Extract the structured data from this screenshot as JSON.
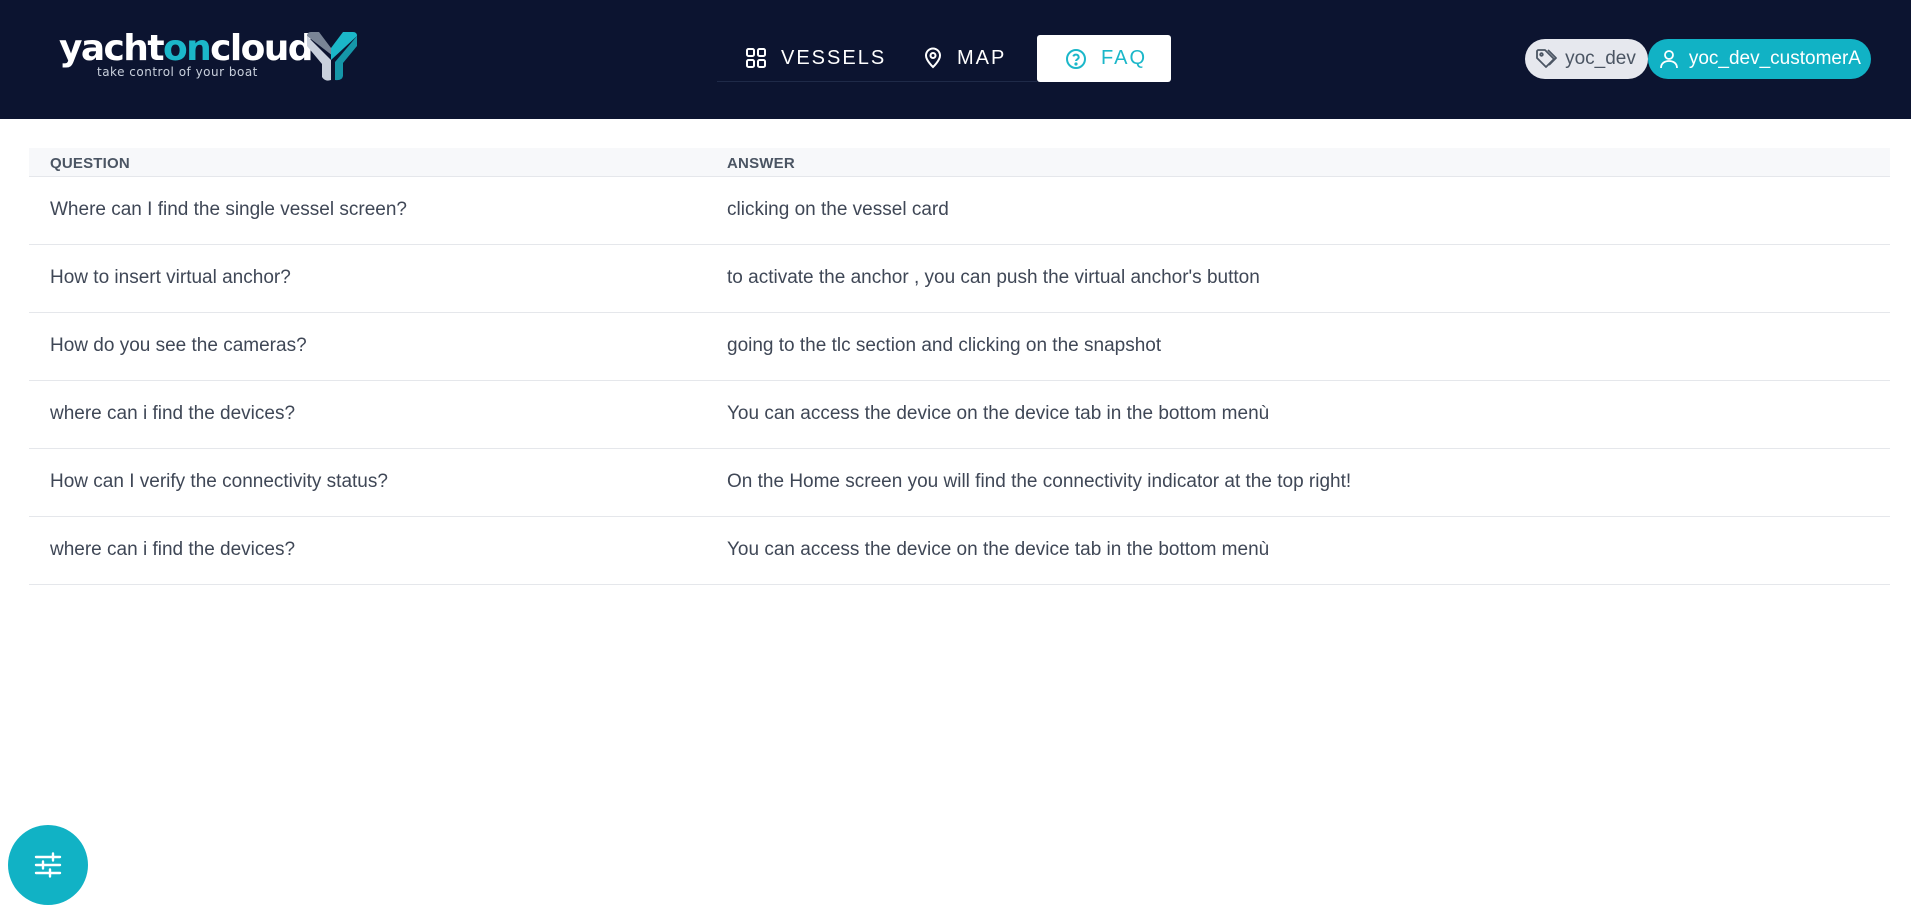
{
  "brand": {
    "name_part1": "yacht",
    "name_part2": "on",
    "name_part3": "cloud",
    "tagline": "take control of your boat",
    "accent_color": "#1bb7c9",
    "header_bg": "#0c1430"
  },
  "nav": {
    "items": [
      {
        "label": "VESSELS",
        "icon": "grid-icon",
        "active": false
      },
      {
        "label": "MAP",
        "icon": "map-pin-icon",
        "active": false
      },
      {
        "label": "FAQ",
        "icon": "help-circle-icon",
        "active": true
      }
    ]
  },
  "account": {
    "tag_label": "yoc_dev",
    "tag_icon": "tag-icon",
    "user_label": "yoc_dev_customerA",
    "user_icon": "user-icon"
  },
  "faq_table": {
    "headers": {
      "question": "QUESTION",
      "answer": "ANSWER"
    },
    "rows": [
      {
        "question": "Where can I find the single vessel screen?",
        "answer": "clicking on the vessel card"
      },
      {
        "question": "How to insert virtual anchor?",
        "answer": "to activate the anchor , you can push the virtual anchor's button"
      },
      {
        "question": "How do you see the cameras?",
        "answer": "going to the tlc section and clicking on the snapshot"
      },
      {
        "question": "where can i find the devices?",
        "answer": "You can access the device on the device tab in the bottom menù"
      },
      {
        "question": "How can I verify the connectivity status?",
        "answer": "On the Home screen you will find the connectivity indicator at the top right!"
      },
      {
        "question": "where can i find the devices?",
        "answer": "You can access the device on the device tab in the bottom menù"
      }
    ]
  },
  "fab": {
    "icon": "sliders-icon"
  }
}
